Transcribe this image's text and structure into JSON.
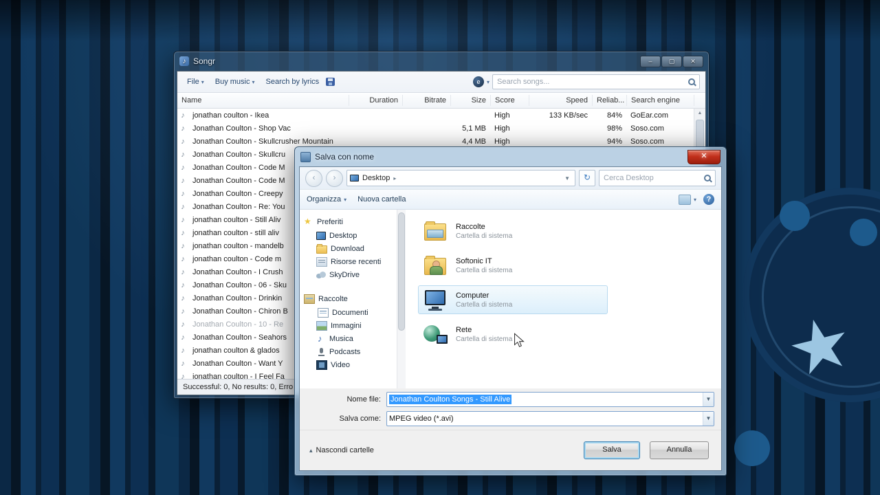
{
  "songr": {
    "title": "Songr",
    "window_buttons": {
      "minimize": "–",
      "maximize": "▢",
      "close": "✕"
    },
    "menu": {
      "file": "File",
      "buy_music": "Buy music",
      "search_by_lyrics": "Search by lyrics"
    },
    "search_placeholder": "Search songs...",
    "columns": [
      "Name",
      "Duration",
      "Bitrate",
      "Size",
      "Score",
      "Speed",
      "Reliab...",
      "Search engine"
    ],
    "rows": [
      {
        "name": "jonathan coulton - Ikea",
        "size": "",
        "score": "High",
        "speed": "133 KB/sec",
        "rel": "84%",
        "engine": "GoEar.com"
      },
      {
        "name": "Jonathan Coulton - Shop Vac",
        "size": "5,1 MB",
        "score": "High",
        "speed": "",
        "rel": "98%",
        "engine": "Soso.com"
      },
      {
        "name": "Jonathan Coulton - Skullcrusher Mountain",
        "size": "4,4 MB",
        "score": "High",
        "speed": "",
        "rel": "94%",
        "engine": "Soso.com"
      },
      {
        "name": "Jonathan Coulton - Skullcru",
        "size": "",
        "score": "",
        "speed": "",
        "rel": "",
        "engine": ""
      },
      {
        "name": "Jonathan Coulton - Code M",
        "size": "",
        "score": "",
        "speed": "",
        "rel": "",
        "engine": ""
      },
      {
        "name": "Jonathan Coulton - Code M",
        "size": "",
        "score": "",
        "speed": "",
        "rel": "",
        "engine": ""
      },
      {
        "name": "Jonathan Coulton - Creepy",
        "size": "",
        "score": "",
        "speed": "",
        "rel": "",
        "engine": ""
      },
      {
        "name": "Jonathan Coulton - Re: You",
        "size": "",
        "score": "",
        "speed": "",
        "rel": "",
        "engine": ""
      },
      {
        "name": "jonathan coulton - Still Aliv",
        "size": "",
        "score": "",
        "speed": "",
        "rel": "",
        "engine": ""
      },
      {
        "name": "jonathan coulton - still aliv",
        "size": "",
        "score": "",
        "speed": "",
        "rel": "",
        "engine": ""
      },
      {
        "name": "jonathan coulton - mandelb",
        "size": "",
        "score": "",
        "speed": "",
        "rel": "",
        "engine": ""
      },
      {
        "name": "jonathan coulton - Code m",
        "size": "",
        "score": "",
        "speed": "",
        "rel": "",
        "engine": ""
      },
      {
        "name": "Jonathan Coulton - I Crush",
        "size": "",
        "score": "",
        "speed": "",
        "rel": "",
        "engine": ""
      },
      {
        "name": "Jonathan Coulton - 06 - Sku",
        "size": "",
        "score": "",
        "speed": "",
        "rel": "",
        "engine": ""
      },
      {
        "name": "Jonathan Coulton - Drinkin",
        "size": "",
        "score": "",
        "speed": "",
        "rel": "",
        "engine": ""
      },
      {
        "name": "Jonathan Coulton - Chiron B",
        "size": "",
        "score": "",
        "speed": "",
        "rel": "",
        "engine": ""
      },
      {
        "name": "Jonathan Coulton - 10 - Re",
        "size": "",
        "score": "",
        "speed": "",
        "rel": "",
        "engine": "",
        "dim": true
      },
      {
        "name": "Jonathan Coulton - Seahors",
        "size": "",
        "score": "",
        "speed": "",
        "rel": "",
        "engine": ""
      },
      {
        "name": "jonathan coulton & glados",
        "size": "",
        "score": "",
        "speed": "",
        "rel": "",
        "engine": ""
      },
      {
        "name": "Jonathan Coulton - Want Y",
        "size": "",
        "score": "",
        "speed": "",
        "rel": "",
        "engine": ""
      },
      {
        "name": "jonathan coulton - I Feel Fa",
        "size": "",
        "score": "",
        "speed": "",
        "rel": "",
        "engine": ""
      }
    ],
    "status": "Successful: 0, No results: 0, Erro"
  },
  "dialog": {
    "title": "Salva con nome",
    "close_label": "✕",
    "breadcrumb": {
      "location": "Desktop"
    },
    "search_placeholder": "Cerca Desktop",
    "toolbar": {
      "organize": "Organizza",
      "new_folder": "Nuova cartella"
    },
    "sidebar": {
      "groups": [
        {
          "label": "Preferiti",
          "icon": "star",
          "items": [
            {
              "label": "Desktop",
              "icon": "monitor"
            },
            {
              "label": "Download",
              "icon": "folder"
            },
            {
              "label": "Risorse recenti",
              "icon": "recent"
            },
            {
              "label": "SkyDrive",
              "icon": "cloud"
            }
          ]
        },
        {
          "label": "Raccolte",
          "icon": "library",
          "items": [
            {
              "label": "Documenti",
              "icon": "doc"
            },
            {
              "label": "Immagini",
              "icon": "image"
            },
            {
              "label": "Musica",
              "icon": "music"
            },
            {
              "label": "Podcasts",
              "icon": "podcast"
            },
            {
              "label": "Video",
              "icon": "video"
            }
          ]
        }
      ]
    },
    "files": [
      {
        "name": "Raccolte",
        "type": "Cartella di sistema",
        "icon": "libraries",
        "selected": false
      },
      {
        "name": "Softonic IT",
        "type": "Cartella di sistema",
        "icon": "user",
        "selected": false
      },
      {
        "name": "Computer",
        "type": "Cartella di sistema",
        "icon": "computer",
        "selected": true
      },
      {
        "name": "Rete",
        "type": "Cartella di sistema",
        "icon": "network",
        "selected": false
      }
    ],
    "filename": {
      "label": "Nome file:",
      "value": "Jonathan Coulton Songs - Still Alive"
    },
    "filetype": {
      "label": "Salva come:",
      "value": "MPEG video (*.avi)"
    },
    "hide_folders": "Nascondi cartelle",
    "buttons": {
      "save": "Salva",
      "cancel": "Annulla"
    }
  }
}
